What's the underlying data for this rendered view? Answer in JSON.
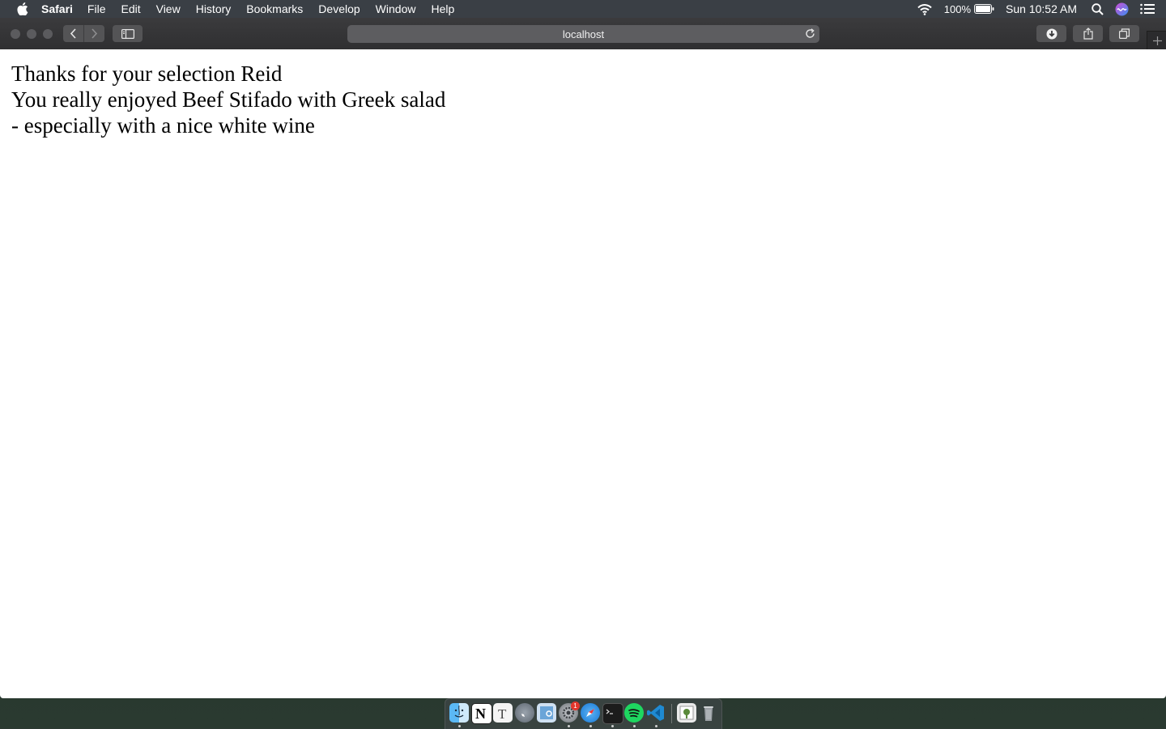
{
  "menubar": {
    "app_name": "Safari",
    "menus": [
      "File",
      "Edit",
      "View",
      "History",
      "Bookmarks",
      "Develop",
      "Window",
      "Help"
    ],
    "battery_percent": "100%",
    "clock": "Sun 10:52 AM"
  },
  "toolbar": {
    "address": "localhost"
  },
  "page": {
    "lines": [
      "Thanks for your selection Reid",
      "You really enjoyed Beef Stifado with Greek salad",
      "- especially with a nice white wine"
    ]
  },
  "dock": {
    "apps": [
      "Finder",
      "Notion",
      "Typora",
      "Launchpad",
      "Preview",
      "System Preferences",
      "Safari",
      "Terminal",
      "Spotify",
      "Visual Studio Code",
      "Downloads",
      "Trash"
    ],
    "system_preferences_badge": "1"
  }
}
